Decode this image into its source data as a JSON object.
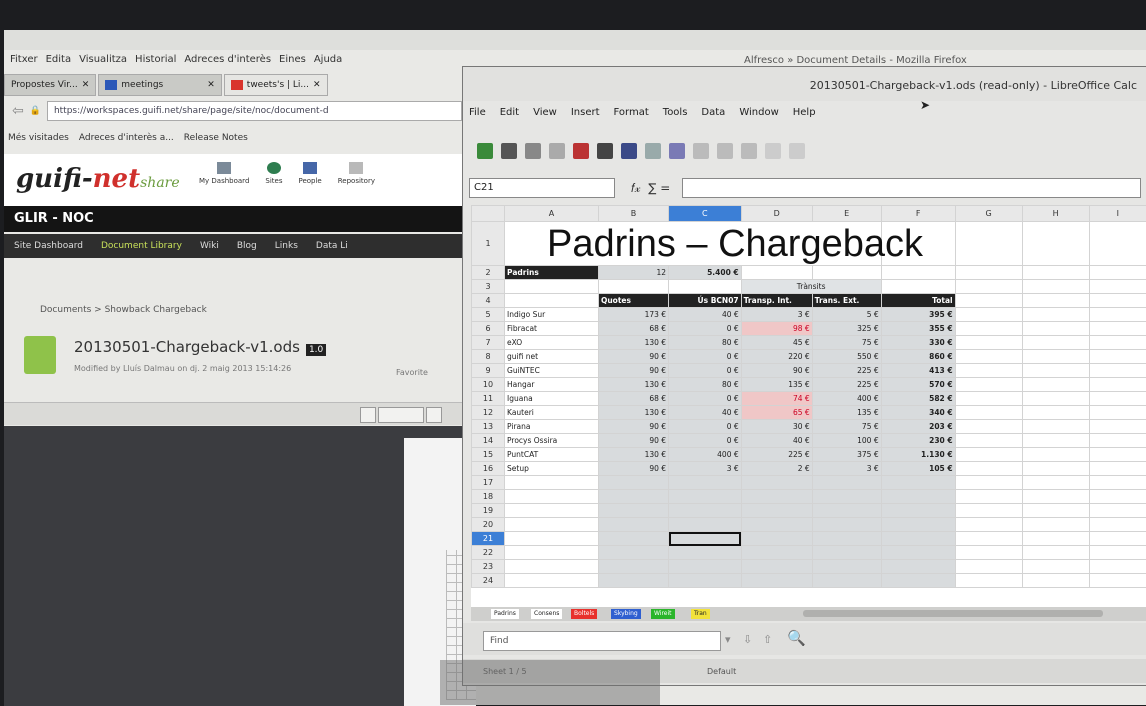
{
  "firefox": {
    "window_title": "Alfresco » Document Details - Mozilla Firefox",
    "menu": [
      "Fitxer",
      "Edita",
      "Visualitza",
      "Historial",
      "Adreces d'interès",
      "Eines",
      "Ajuda"
    ],
    "tabs": [
      {
        "label": "Propostes Vir...",
        "active": false
      },
      {
        "label": "meetings",
        "active": false
      },
      {
        "label": "",
        "active": false
      },
      {
        "label": "tweets's | Li...",
        "active": true
      }
    ],
    "url": "https://workspaces.guifi.net/share/page/site/noc/document-d",
    "bookmarks": [
      "Més visitades",
      "Adreces d'interès a...",
      "Release Notes"
    ],
    "site": {
      "logo_main": "guifi-",
      "logo_net": "net",
      "logo_share": "share",
      "nav": [
        "My Dashboard",
        "Sites",
        "People",
        "Repository"
      ],
      "site_name": "GLIR - NOC",
      "subnav": [
        "Site Dashboard",
        "Document Library",
        "Wiki",
        "Blog",
        "Links",
        "Data Li"
      ],
      "breadcrumb": "Documents  >  Showback Chargeback",
      "document_name": "20130501-Chargeback-v1.ods",
      "document_badge": "1.0",
      "modified": "Modified by Lluís Dalmau on dj. 2 maig 2013 15:14:26",
      "favorite": "Favorite"
    }
  },
  "calc": {
    "window_title": "20130501-Chargeback-v1.ods (read-only) - LibreOffice Calc",
    "menu": [
      "File",
      "Edit",
      "View",
      "Insert",
      "Format",
      "Tools",
      "Data",
      "Window",
      "Help"
    ],
    "name_box": "C21",
    "formula_symbols": "∑  =",
    "columns": [
      "A",
      "B",
      "C",
      "D",
      "E",
      "F",
      "G",
      "H",
      "I"
    ],
    "selected_column": "C",
    "selected_row": "21",
    "sheet_title": "Padrins – Chargeback",
    "padrins_label": "Padrins",
    "padrins_count": "12",
    "padrins_amount": "5.400 €",
    "transits_label": "Trànsits",
    "headers": [
      "Quotes",
      "Ús BCN07",
      "Transp. Int.",
      "Trans. Ext.",
      "Total"
    ],
    "rows": [
      {
        "row": "5",
        "name": "Indigo Sur",
        "vals": [
          "173 €",
          "40 €",
          "3 €",
          "5 €",
          "395 €"
        ],
        "red": false
      },
      {
        "row": "6",
        "name": "Fibracat",
        "vals": [
          "68 €",
          "0 €",
          "98 €",
          "325 €",
          "355 €"
        ],
        "red": true
      },
      {
        "row": "7",
        "name": "eXO",
        "vals": [
          "130 €",
          "80 €",
          "45 €",
          "75 €",
          "330 €"
        ],
        "red": false
      },
      {
        "row": "8",
        "name": "guifi net",
        "vals": [
          "90 €",
          "0 €",
          "220 €",
          "550 €",
          "860 €"
        ],
        "red": false
      },
      {
        "row": "9",
        "name": "GuiNTEC",
        "vals": [
          "90 €",
          "0 €",
          "90 €",
          "225 €",
          "413 €"
        ],
        "red": false
      },
      {
        "row": "10",
        "name": "Hangar",
        "vals": [
          "130 €",
          "80 €",
          "135 €",
          "225 €",
          "570 €"
        ],
        "red": false
      },
      {
        "row": "11",
        "name": "Iguana",
        "vals": [
          "68 €",
          "0 €",
          "74 €",
          "400 €",
          "582 €"
        ],
        "red": true
      },
      {
        "row": "12",
        "name": "Kauteri",
        "vals": [
          "130 €",
          "40 €",
          "65 €",
          "135 €",
          "340 €"
        ],
        "red": true
      },
      {
        "row": "13",
        "name": "Pirana",
        "vals": [
          "90 €",
          "0 €",
          "30 €",
          "75 €",
          "203 €"
        ],
        "red": false
      },
      {
        "row": "14",
        "name": "Procys Ossira",
        "vals": [
          "90 €",
          "0 €",
          "40 €",
          "100 €",
          "230 €"
        ],
        "red": false
      },
      {
        "row": "15",
        "name": "PuntCAT",
        "vals": [
          "130 €",
          "400 €",
          "225 €",
          "375 €",
          "1.130 €"
        ],
        "red": false
      },
      {
        "row": "16",
        "name": "Setup",
        "vals": [
          "90 €",
          "3 €",
          "2 €",
          "3 €",
          "105 €"
        ],
        "red": false
      }
    ],
    "empty_rows": [
      "17",
      "18",
      "19",
      "20",
      "21",
      "22",
      "23",
      "24"
    ],
    "sheet_tabs": [
      {
        "label": "Padrins",
        "color": "#ffffff"
      },
      {
        "label": "Consens",
        "color": "#ffffff"
      },
      {
        "label": "Boltels",
        "color": "#e8312c"
      },
      {
        "label": "Skybing",
        "color": "#2f5fd0"
      },
      {
        "label": "Wireit",
        "color": "#2ab52a"
      },
      {
        "label": "Tran",
        "color": "#f2e23a"
      }
    ],
    "find_placeholder": "Find",
    "status_sheet": "Sheet 1 / 5",
    "status_style": "Default"
  }
}
